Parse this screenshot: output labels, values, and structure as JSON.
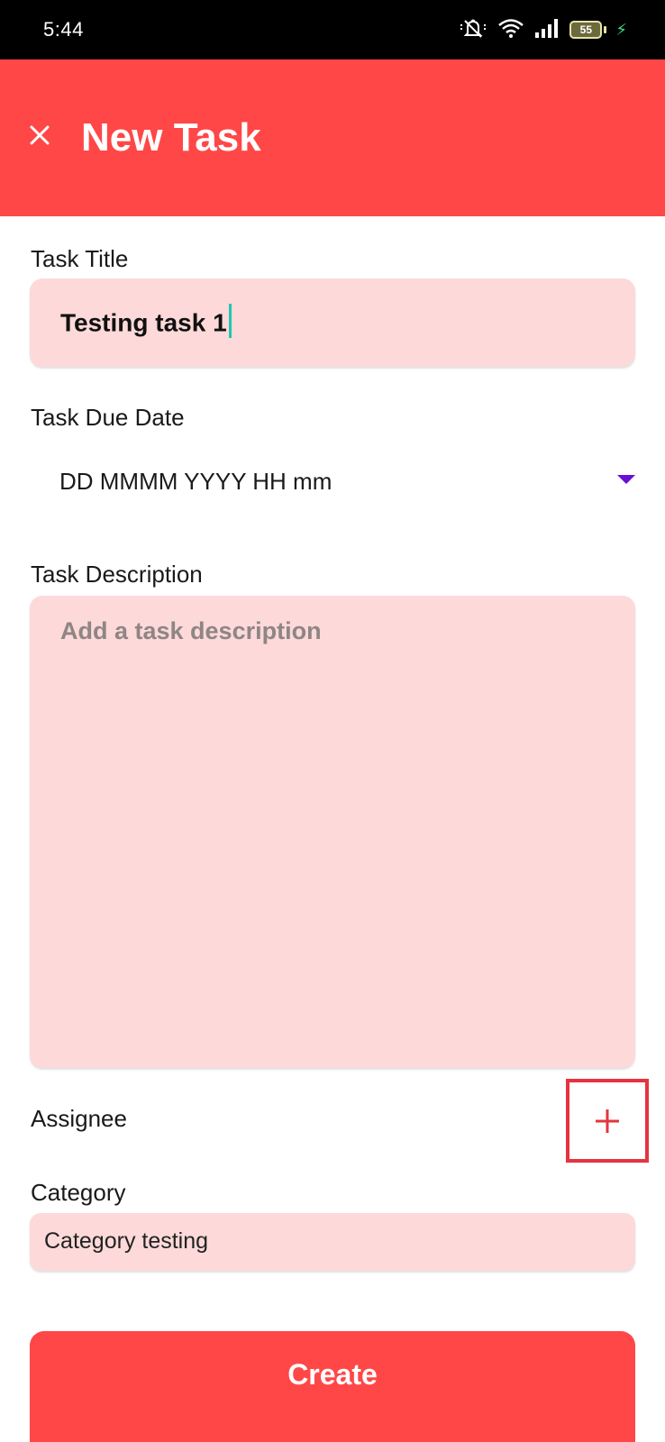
{
  "status_bar": {
    "time": "5:44",
    "icons": [
      "mute-icon",
      "wifi-icon",
      "signal-icon",
      "battery-icon",
      "charging-icon"
    ],
    "battery_level": "55"
  },
  "app_bar": {
    "title": "New Task",
    "close_icon": "close-icon",
    "color": "#ff4747"
  },
  "form": {
    "title_label": "Task Title",
    "title_value": "Testing task 1",
    "due_date_label": "Task Due Date",
    "due_date_value": "DD MMMM YYYY HH mm",
    "description_label": "Task Description",
    "description_placeholder": "Add a task description",
    "assignee_label": "Assignee",
    "add_assignee_icon": "plus-icon",
    "category_label": "Category",
    "category_value": "Category testing",
    "create_button": "Create"
  },
  "colors": {
    "accent": "#ff4747",
    "field_bg": "#fdd9d9",
    "dropdown_arrow": "#6a0ed6",
    "highlight_border": "#e4343f"
  }
}
